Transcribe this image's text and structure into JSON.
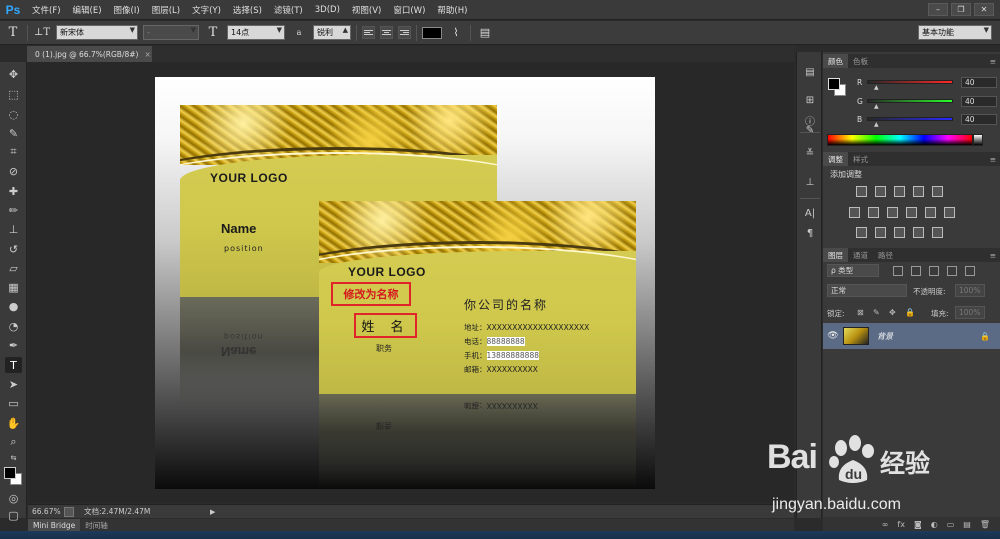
{
  "app": {
    "logo": "Ps",
    "menu": [
      "文件(F)",
      "编辑(E)",
      "图像(I)",
      "图层(L)",
      "文字(Y)",
      "选择(S)",
      "滤镜(T)",
      "3D(D)",
      "视图(V)",
      "窗口(W)",
      "帮助(H)"
    ],
    "window_controls": [
      "–",
      "❐",
      "✕"
    ]
  },
  "options": {
    "font_family": "新宋体",
    "font_style": "-",
    "font_size": "14点",
    "antialias_icon": "a",
    "antialias": "锐利",
    "workspace": "基本功能",
    "text_color": "#000000"
  },
  "document": {
    "tab_label": "0 (1).jpg @ 66.7%(RGB/8#)",
    "tab_close": "×",
    "zoom": "66.67%",
    "doc_size": "文档:2.47M/2.47M"
  },
  "card_back": {
    "logo": "YOUR LOGO",
    "name": "Name",
    "position": "position"
  },
  "card_front": {
    "logo": "YOUR LOGO",
    "company_placeholder": "修改为名称",
    "name": "姓 名",
    "title": "职务",
    "company_name": "你公司的名称",
    "address": "地址：XXXXXXXXXXXXXXXXXXXX",
    "phone_label": "电话：",
    "phone_value": "88888888",
    "mobile_label": "手机：",
    "mobile_value": "13888888888",
    "email": "邮箱：XXXXXXXXXX"
  },
  "reflections": {
    "back_position": "position",
    "back_name": "Name",
    "front_line": "邮箱：XXXXXXXXXX",
    "front_title": "职务"
  },
  "bottom_tabs": [
    "Mini Bridge",
    "时间轴"
  ],
  "color_panel": {
    "tabs": [
      "颜色",
      "色板"
    ],
    "channels": [
      {
        "label": "R",
        "value": "40",
        "color": "#e02020"
      },
      {
        "label": "G",
        "value": "40",
        "color": "#20c020"
      },
      {
        "label": "B",
        "value": "40",
        "color": "#2040e0"
      }
    ]
  },
  "adjust_panel": {
    "tabs": [
      "调整",
      "样式"
    ],
    "title": "添加调整"
  },
  "layers_panel": {
    "tabs": [
      "图层",
      "通道",
      "路径"
    ],
    "filter": "ρ 类型",
    "blend_mode": "正常",
    "opacity_label": "不透明度:",
    "opacity_value": "100%",
    "lock_label": "锁定:",
    "fill_label": "填充:",
    "fill_value": "100%",
    "layer_name": "背景",
    "footer_icons": [
      "∞",
      "fx",
      "◙",
      "◐",
      "▭",
      "▤",
      "🗑"
    ]
  },
  "watermark": {
    "brand": "Bai",
    "brand_zh": "经验",
    "url": "jingyan.baidu.com"
  }
}
